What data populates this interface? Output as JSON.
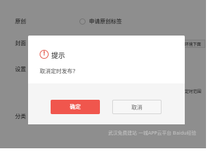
{
  "background": {
    "labels": {
      "original": "原创",
      "apply_original_tag": "申请原创标签",
      "cover": "封面",
      "cover_right": "h环境下面",
      "settings": "设置",
      "timer_right": "定时范围",
      "category": "分类"
    }
  },
  "dialog": {
    "icon": "warning-circle-icon",
    "icon_glyph": "!",
    "title": "提示",
    "message": "取消定时发布?",
    "confirm_label": "确定",
    "cancel_label": "取消"
  },
  "watermark": {
    "text": "武汉免费建站  一城APP云平台  Baidu经验"
  },
  "colors": {
    "accent": "#f0564d",
    "icon": "#e45b4f",
    "overlay": "rgba(0,0,0,0.44)"
  }
}
